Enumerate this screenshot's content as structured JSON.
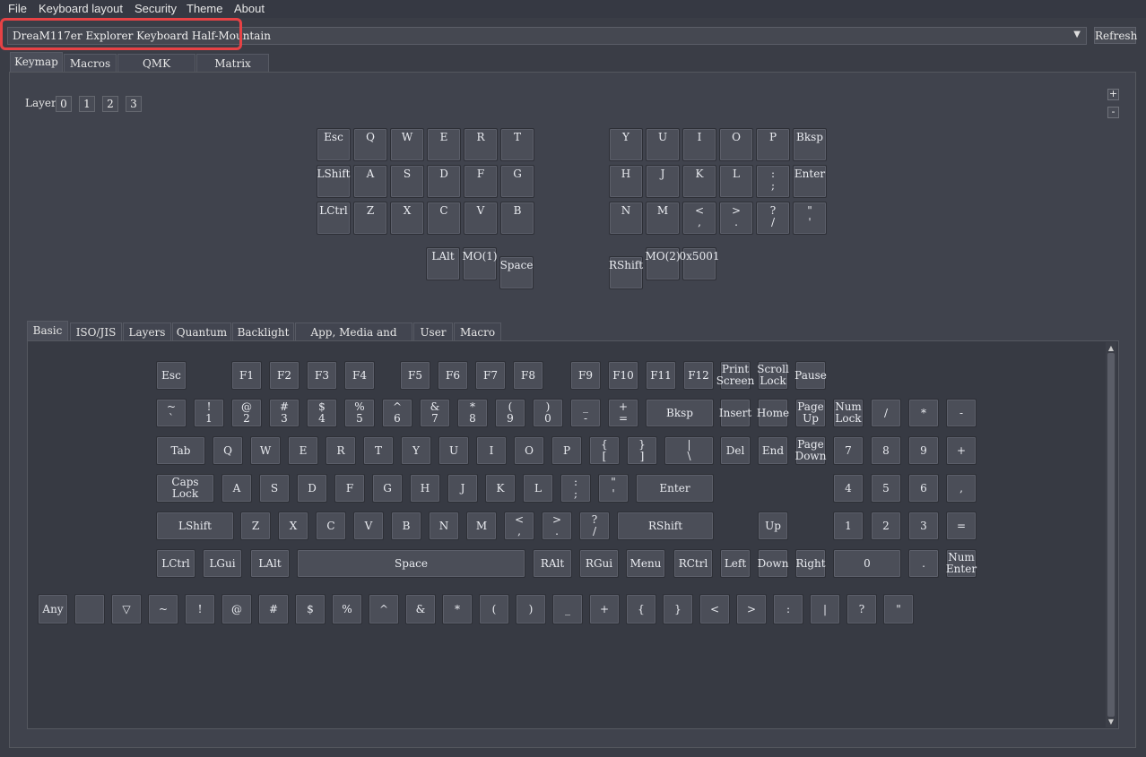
{
  "menu": [
    "File",
    "Keyboard layout",
    "Security",
    "Theme",
    "About"
  ],
  "keyboard_select": {
    "value": "DreaM117er Explorer Keyboard Half-Mountain"
  },
  "refresh_label": "Refresh",
  "tabs": [
    "Keymap",
    "Macros",
    "QMK Settings",
    "Matrix tester"
  ],
  "layer": {
    "label": "Layer",
    "buttons": [
      "0",
      "1",
      "2",
      "3"
    ],
    "plus": "+",
    "minus": "-"
  },
  "keymap_keys": [
    "Esc",
    "Q",
    "W",
    "E",
    "R",
    "T",
    "Y",
    "U",
    "I",
    "O",
    "P",
    "Bksp",
    "LShift",
    "A",
    "S",
    "D",
    "F",
    "G",
    "H",
    "J",
    "K",
    "L",
    ":\n;",
    "Enter",
    "LCtrl",
    "Z",
    "X",
    "C",
    "V",
    "B",
    "N",
    "M",
    "<\n,",
    ">\n.",
    "?\n/",
    "\"\n'",
    "LAlt",
    "MO(1)",
    "Space",
    "RShift",
    "MO(2)",
    "0x5001"
  ],
  "inner_tabs": [
    "Basic",
    "ISO/JIS",
    "Layers",
    "Quantum",
    "Backlight",
    "App, Media and Mouse",
    "User",
    "Macro"
  ],
  "basic_keys": [
    "Esc",
    "F1",
    "F2",
    "F3",
    "F4",
    "F5",
    "F6",
    "F7",
    "F8",
    "F9",
    "F10",
    "F11",
    "F12",
    "Print\nScreen",
    "Scroll\nLock",
    "Pause",
    "~\n`",
    "!\n1",
    "@\n2",
    "#\n3",
    "$\n4",
    "%\n5",
    "^\n6",
    "&\n7",
    "*\n8",
    "(\n9",
    ")\n0",
    "_\n-",
    "+\n=",
    "Bksp",
    "Insert",
    "Home",
    "Page\nUp",
    "Num\nLock",
    "/",
    "*",
    "-",
    "Tab",
    "Q",
    "W",
    "E",
    "R",
    "T",
    "Y",
    "U",
    "I",
    "O",
    "P",
    "{\n[",
    "}\n]",
    "|\n\\",
    "Del",
    "End",
    "Page\nDown",
    "7",
    "8",
    "9",
    "+",
    "Caps\nLock",
    "A",
    "S",
    "D",
    "F",
    "G",
    "H",
    "J",
    "K",
    "L",
    ":\n;",
    "\"\n'",
    "Enter",
    "4",
    "5",
    "6",
    ",",
    "LShift",
    "Z",
    "X",
    "C",
    "V",
    "B",
    "N",
    "M",
    "<\n,",
    ">\n.",
    "?\n/",
    "RShift",
    "Up",
    "1",
    "2",
    "3",
    "=",
    "LCtrl",
    "LGui",
    "LAlt",
    "Space",
    "RAlt",
    "RGui",
    "Menu",
    "RCtrl",
    "Left",
    "Down",
    "Right",
    "0",
    ".",
    "Num\nEnter",
    "Any",
    "",
    "▽",
    "~",
    "!",
    "@",
    "#",
    "$",
    "%",
    "^",
    "&",
    "*",
    "(",
    ")",
    "_",
    "+",
    "{",
    "}",
    "<",
    ">",
    ":",
    "|",
    "?",
    "\""
  ]
}
